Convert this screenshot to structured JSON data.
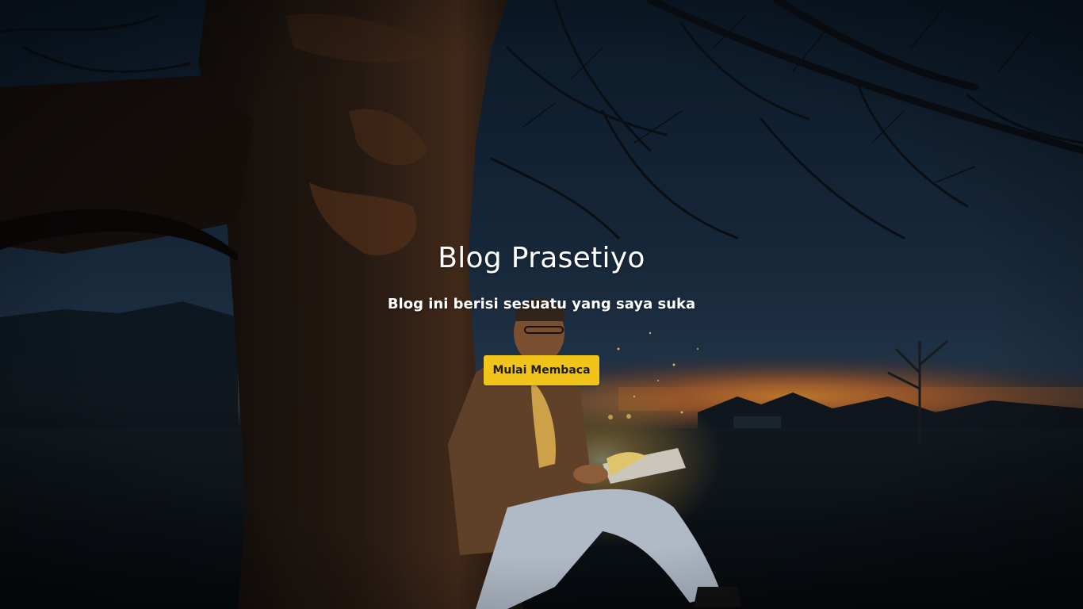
{
  "hero": {
    "title": "Blog Prasetiyo",
    "subtitle": "Blog ini berisi sesuatu yang saya suka",
    "cta_label": "Mulai Membaca",
    "background_image": "photo of a man reading a glowing book under a tree at dusk"
  },
  "colors": {
    "cta_background": "#f0c419",
    "cta_text": "#1c1c1c",
    "title_text": "#ffffff",
    "sky_dark": "#0b1a2b",
    "sunset_glow": "#e08a2a"
  }
}
